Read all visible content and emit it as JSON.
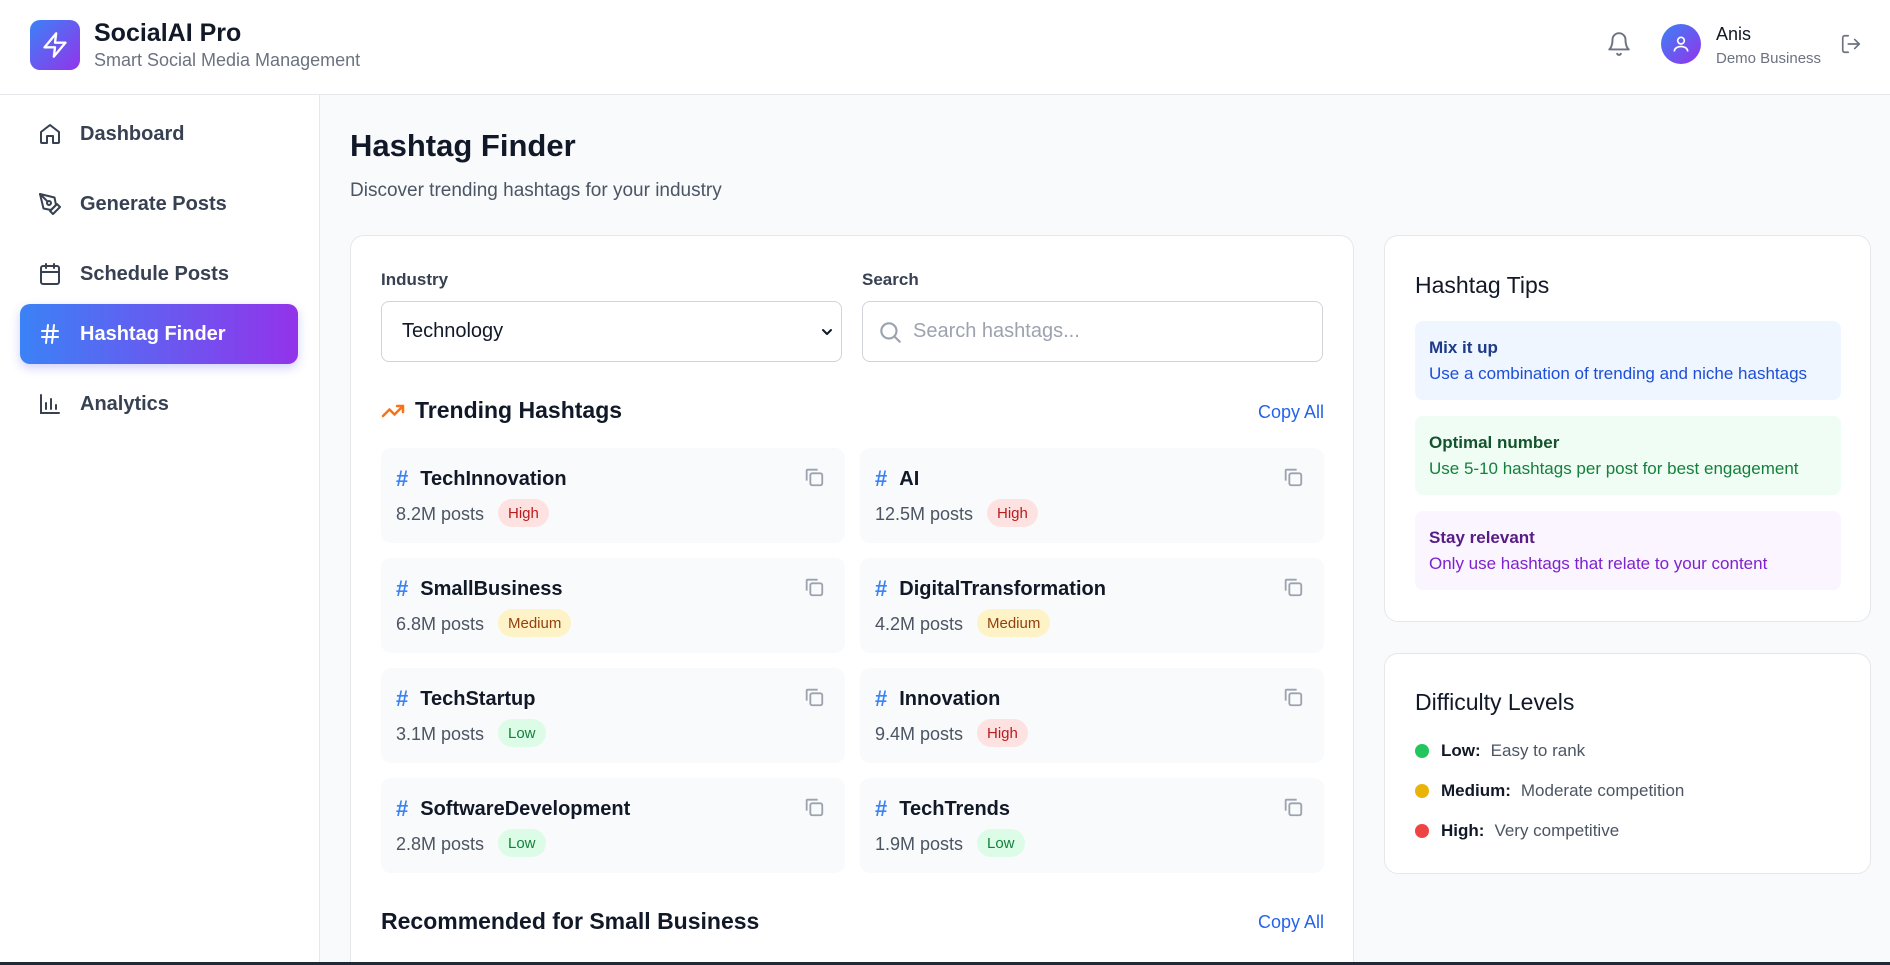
{
  "app": {
    "title": "SocialAI Pro",
    "subtitle": "Smart Social Media Management",
    "brand_gradient": [
      "#3b82f6",
      "#9333ea"
    ]
  },
  "header": {
    "user_name": "Anis",
    "user_business": "Demo Business",
    "icons": [
      "zap-icon",
      "bell-icon",
      "user-icon",
      "logout-icon"
    ]
  },
  "sidebar": {
    "items": [
      {
        "label": "Dashboard",
        "icon": "home-icon",
        "active": false
      },
      {
        "label": "Generate Posts",
        "icon": "pen-tool-icon",
        "active": false
      },
      {
        "label": "Schedule Posts",
        "icon": "calendar-icon",
        "active": false
      },
      {
        "label": "Hashtag Finder",
        "icon": "hash-icon",
        "active": true
      },
      {
        "label": "Analytics",
        "icon": "bar-chart-icon",
        "active": false
      }
    ]
  },
  "main": {
    "title": "Hashtag Finder",
    "subtitle": "Discover trending hashtags for your industry",
    "industry_label": "Industry",
    "industry_value": "Technology",
    "search_label": "Search",
    "search_placeholder": "Search hashtags...",
    "search_value": "",
    "trending_title": "Trending Hashtags",
    "copy_all": "Copy All",
    "recommended_title": "Recommended for Small Business",
    "hashtags": [
      {
        "name": "TechInnovation",
        "posts": "8.2M posts",
        "level": "High"
      },
      {
        "name": "AI",
        "posts": "12.5M posts",
        "level": "High"
      },
      {
        "name": "SmallBusiness",
        "posts": "6.8M posts",
        "level": "Medium"
      },
      {
        "name": "DigitalTransformation",
        "posts": "4.2M posts",
        "level": "Medium"
      },
      {
        "name": "TechStartup",
        "posts": "3.1M posts",
        "level": "Low"
      },
      {
        "name": "Innovation",
        "posts": "9.4M posts",
        "level": "High"
      },
      {
        "name": "SoftwareDevelopment",
        "posts": "2.8M posts",
        "level": "Low"
      },
      {
        "name": "TechTrends",
        "posts": "1.9M posts",
        "level": "Low"
      }
    ]
  },
  "tips": {
    "title": "Hashtag Tips",
    "items": [
      {
        "title": "Mix it up",
        "text": "Use a combination of trending and niche hashtags"
      },
      {
        "title": "Optimal number",
        "text": "Use 5-10 hashtags per post for best engagement"
      },
      {
        "title": "Stay relevant",
        "text": "Only use hashtags that relate to your content"
      }
    ]
  },
  "difficulty": {
    "title": "Difficulty Levels",
    "items": [
      {
        "level": "Low:",
        "desc": "Easy to rank",
        "color": "#22c55e"
      },
      {
        "level": "Medium:",
        "desc": "Moderate competition",
        "color": "#eab308"
      },
      {
        "level": "High:",
        "desc": "Very competitive",
        "color": "#ef4444"
      }
    ]
  }
}
